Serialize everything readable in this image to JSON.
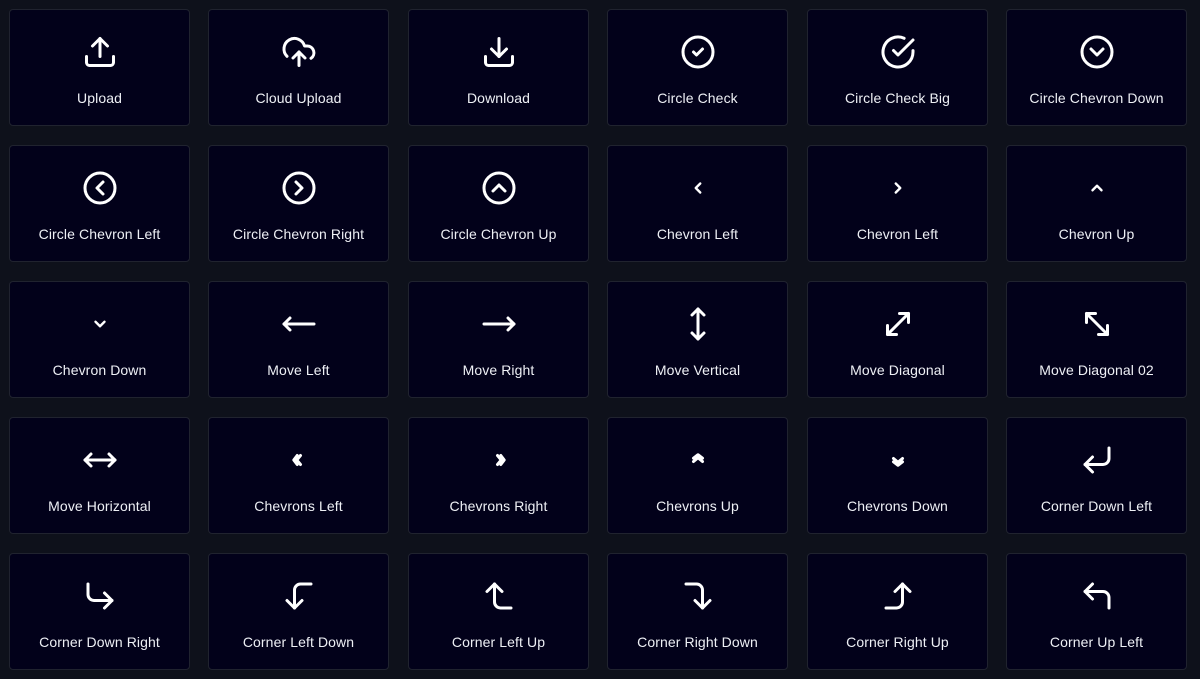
{
  "icons": [
    {
      "label": "Upload",
      "icon": "upload-icon"
    },
    {
      "label": "Cloud Upload",
      "icon": "cloud-upload-icon"
    },
    {
      "label": "Download",
      "icon": "download-icon"
    },
    {
      "label": "Circle Check",
      "icon": "circle-check-icon"
    },
    {
      "label": "Circle Check Big",
      "icon": "circle-check-big-icon"
    },
    {
      "label": "Circle Chevron Down",
      "icon": "circle-chevron-down-icon"
    },
    {
      "label": "Circle Chevron Left",
      "icon": "circle-chevron-left-icon"
    },
    {
      "label": "Circle Chevron Right",
      "icon": "circle-chevron-right-icon"
    },
    {
      "label": "Circle Chevron Up",
      "icon": "circle-chevron-up-icon"
    },
    {
      "label": "Chevron Left",
      "icon": "chevron-left-icon"
    },
    {
      "label": "Chevron Left",
      "icon": "chevron-right-icon"
    },
    {
      "label": "Chevron Up",
      "icon": "chevron-up-icon"
    },
    {
      "label": "Chevron Down",
      "icon": "chevron-down-icon"
    },
    {
      "label": "Move Left",
      "icon": "move-left-icon"
    },
    {
      "label": "Move Right",
      "icon": "move-right-icon"
    },
    {
      "label": "Move Vertical",
      "icon": "move-vertical-icon"
    },
    {
      "label": "Move Diagonal",
      "icon": "move-diagonal-icon"
    },
    {
      "label": "Move Diagonal 02",
      "icon": "move-diagonal-02-icon"
    },
    {
      "label": "Move Horizontal",
      "icon": "move-horizontal-icon"
    },
    {
      "label": "Chevrons Left",
      "icon": "chevrons-left-icon"
    },
    {
      "label": "Chevrons Right",
      "icon": "chevrons-right-icon"
    },
    {
      "label": "Chevrons Up",
      "icon": "chevrons-up-icon"
    },
    {
      "label": "Chevrons Down",
      "icon": "chevrons-down-icon"
    },
    {
      "label": "Corner Down Left",
      "icon": "corner-down-left-icon"
    },
    {
      "label": "Corner Down Right",
      "icon": "corner-down-right-icon"
    },
    {
      "label": "Corner Left Down",
      "icon": "corner-left-down-icon"
    },
    {
      "label": "Corner Left Up",
      "icon": "corner-left-up-icon"
    },
    {
      "label": "Corner Right Down",
      "icon": "corner-right-down-icon"
    },
    {
      "label": "Corner Right Up",
      "icon": "corner-right-up-icon"
    },
    {
      "label": "Corner Up Left",
      "icon": "corner-up-left-icon"
    }
  ],
  "colors": {
    "page_background": "#0e111b",
    "tile_background": "#02011a",
    "tile_border": "#20232f",
    "icon_stroke": "#ffffff",
    "label_text": "#eef0f5"
  }
}
